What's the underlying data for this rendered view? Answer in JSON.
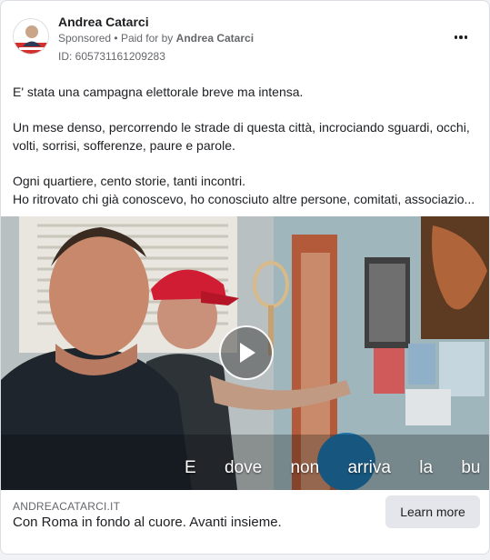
{
  "post": {
    "author_name": "Andrea Catarci",
    "sponsored_label": "Sponsored",
    "separator": "•",
    "paid_for_prefix": "Paid for by",
    "paid_for_by": "Andrea Catarci",
    "ad_id": "ID: 605731161209283",
    "avatar_caption": "ANDREA CATARCI",
    "avatar_badge_color": "#d32f2f"
  },
  "body": {
    "lines": [
      "E' stata una campagna elettorale breve ma intensa.",
      "Un mese denso, percorrendo le strade di questa città, incrociando sguardi, occhi,",
      "volti, sorrisi, sofferenze, paure e parole.",
      "Ogni quartiere, cento storie, tanti incontri.",
      "Ho ritrovato chi già conoscevo, ho conosciuto altre persone, comitati, associazio..."
    ]
  },
  "video": {
    "subtitle_words": [
      "E",
      "dove",
      "non",
      "arriva",
      "la",
      "bu"
    ]
  },
  "link": {
    "domain": "ANDREACATARCI.IT",
    "headline": "Con Roma in fondo al cuore. Avanti insieme.",
    "cta_label": "Learn more"
  },
  "colors": {
    "text_primary": "#1c1e21",
    "text_secondary": "#65676b",
    "button_bg": "#e4e6eb"
  }
}
